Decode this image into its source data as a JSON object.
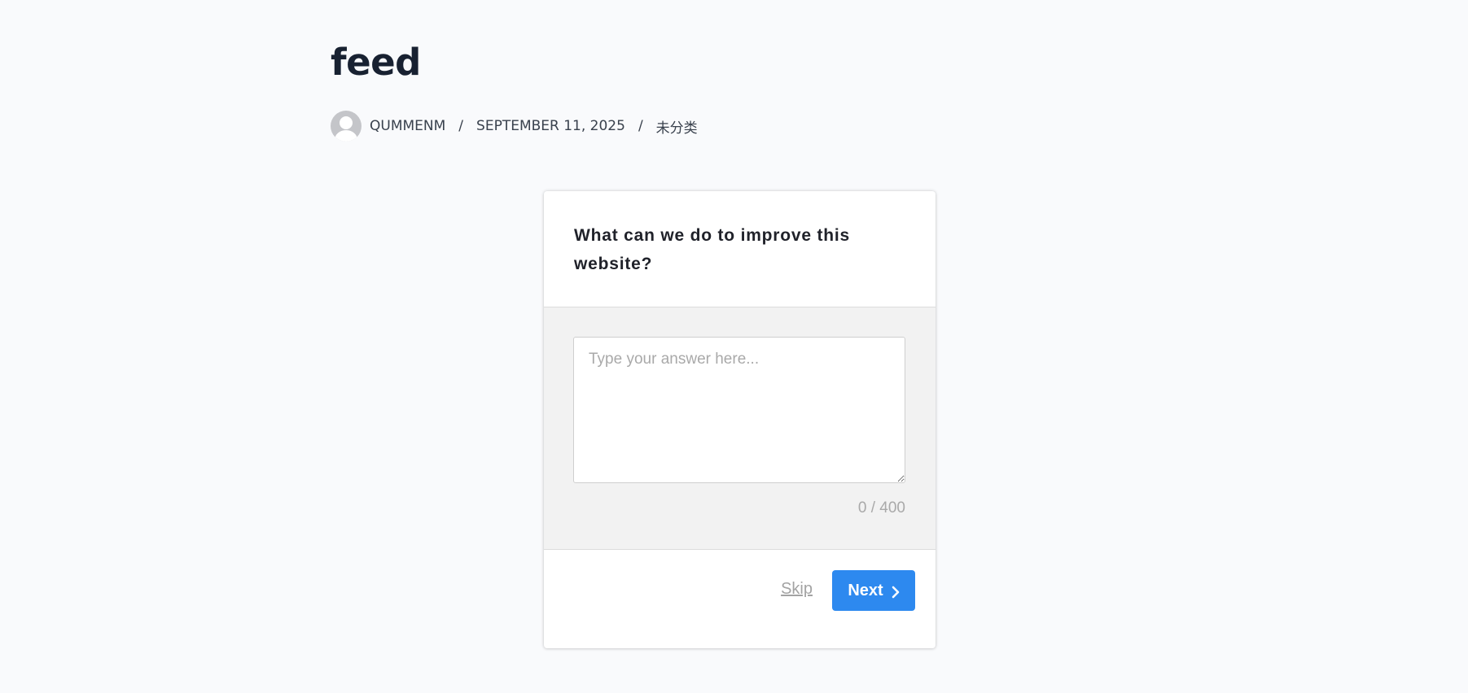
{
  "post": {
    "title": "feed",
    "author": "QUMMENM",
    "date": "SEPTEMBER 11, 2025",
    "category": "未分类",
    "separator": "/"
  },
  "survey": {
    "question": "What can we do to improve this website?",
    "answer_value": "",
    "answer_placeholder": "Type your answer here...",
    "char_counter": "0 / 400",
    "skip_label": "Skip",
    "next_label": "Next"
  },
  "colors": {
    "background": "#f9fafc",
    "accent": "#2d89ef",
    "answer_panel": "#f2f2f2"
  },
  "icons": {
    "avatar": "user-avatar-icon",
    "next": "chevron-right-icon"
  }
}
